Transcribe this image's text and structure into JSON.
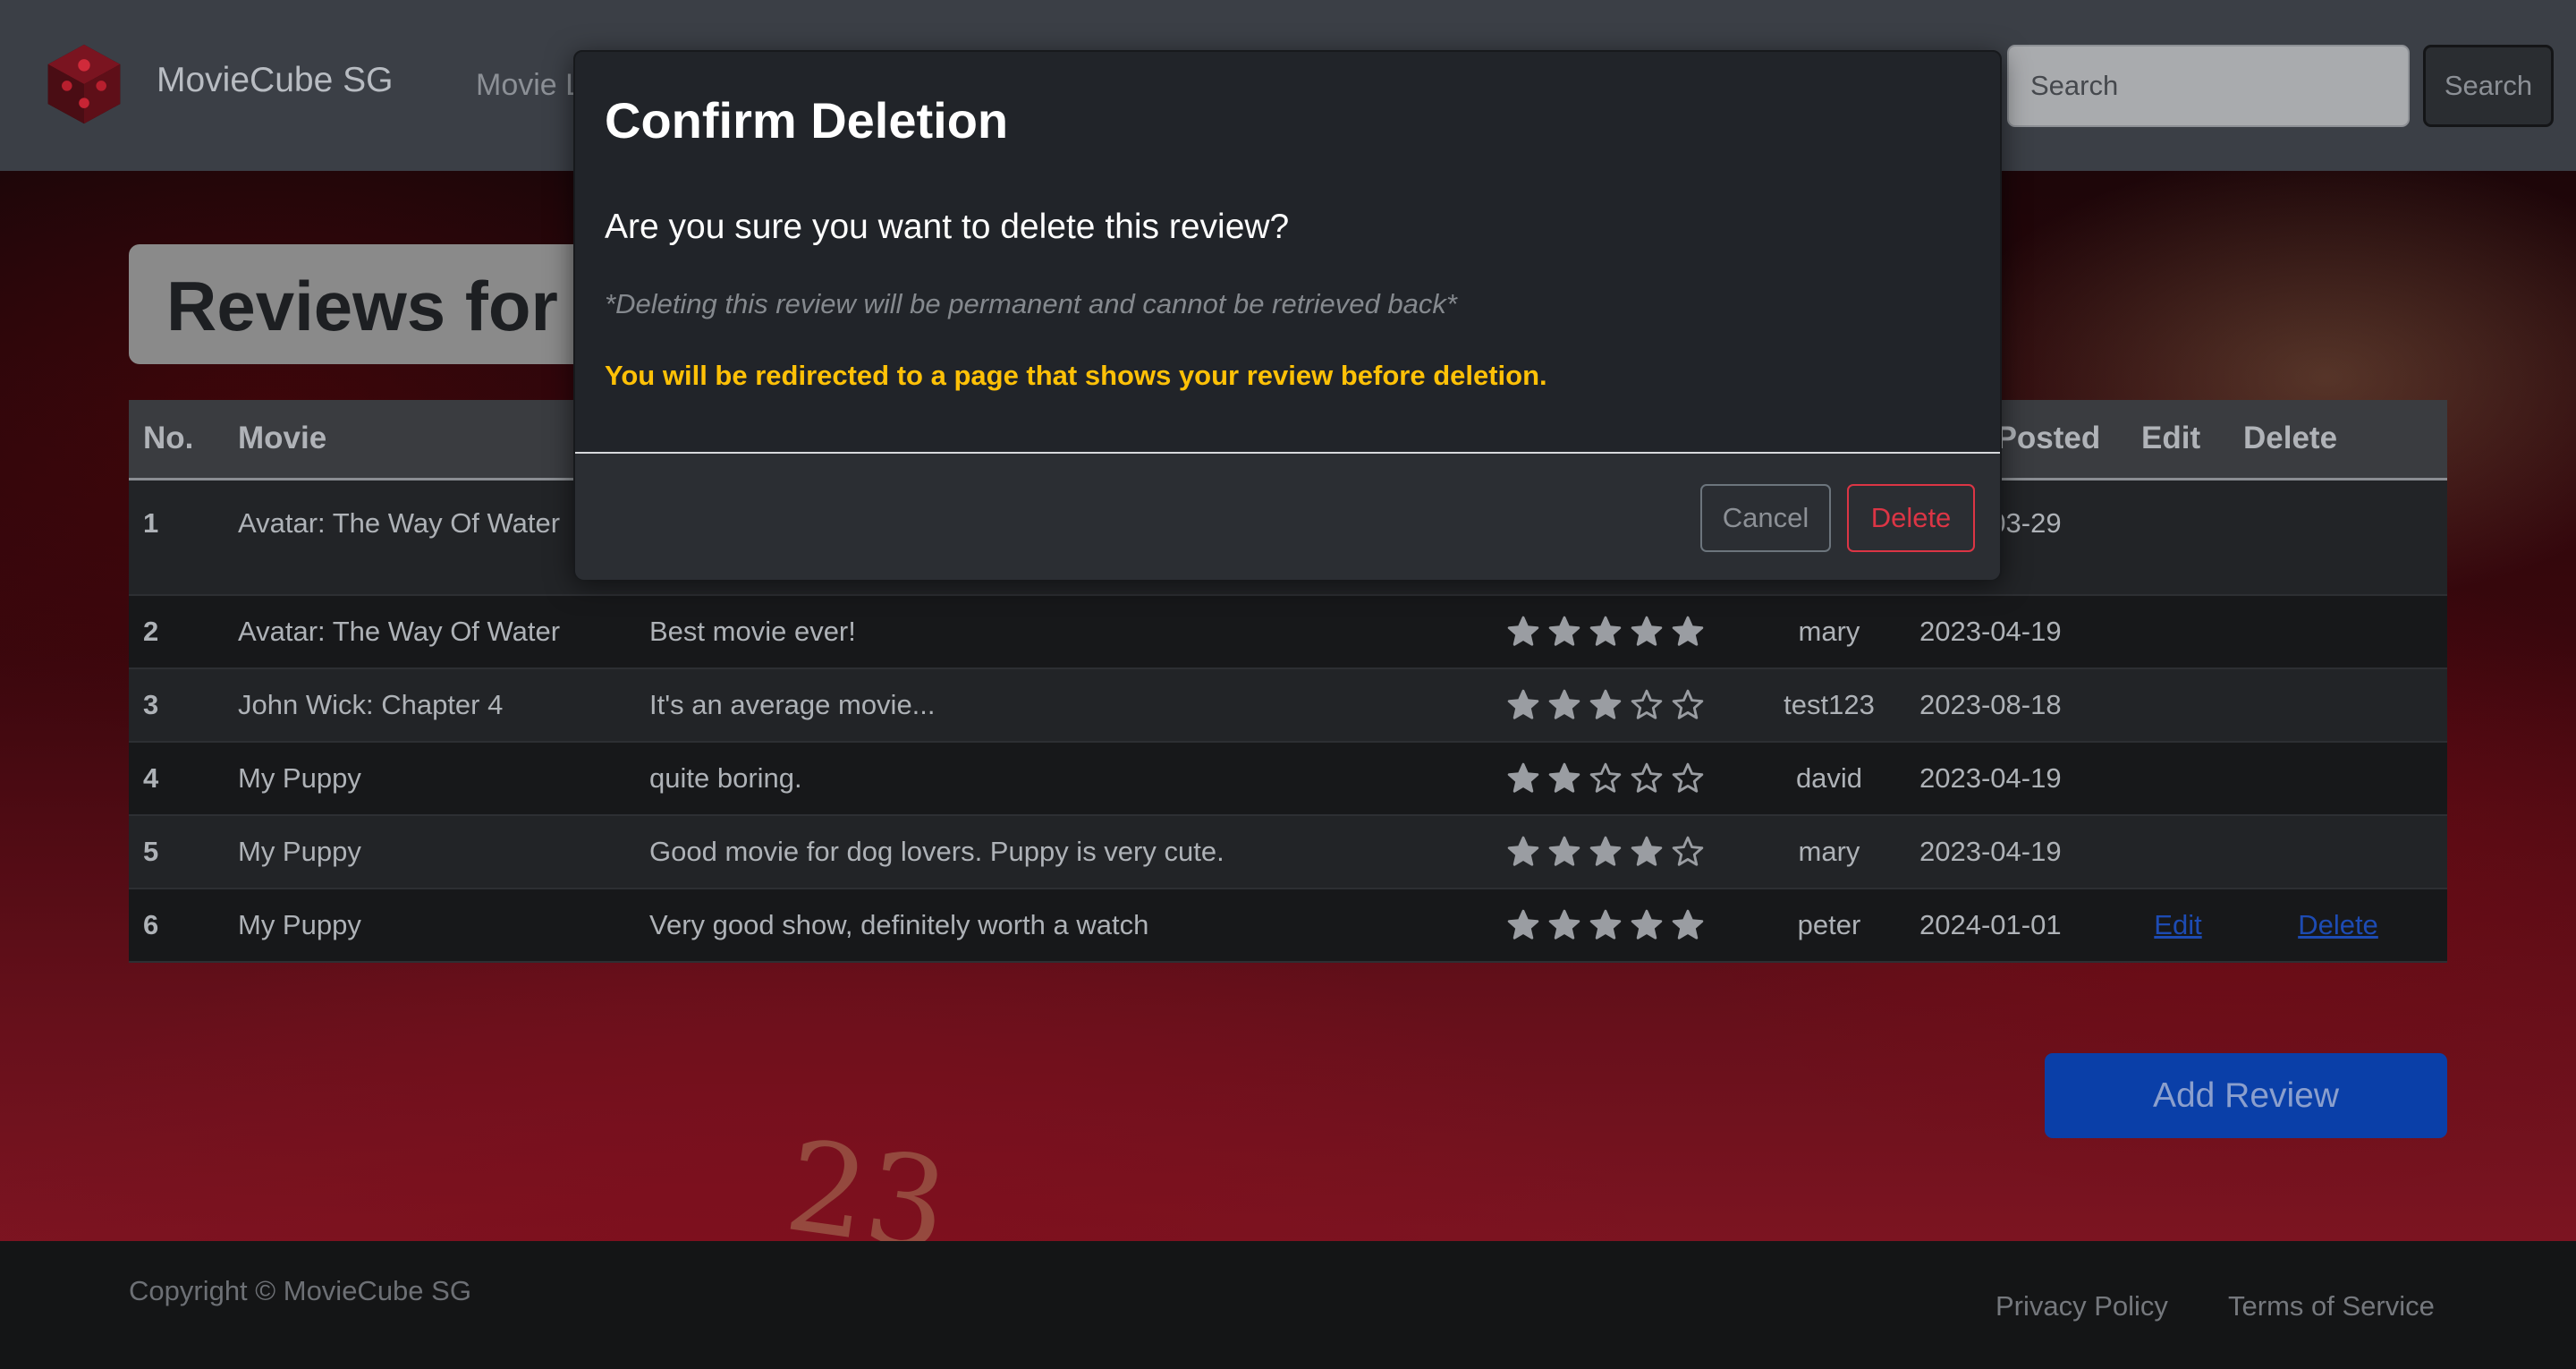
{
  "navbar": {
    "brand": "MovieCube SG",
    "nav_link": "Movie L",
    "search_placeholder": "Search",
    "search_button": "Search"
  },
  "page": {
    "heading": "Reviews for A"
  },
  "table": {
    "headers": {
      "no": "No.",
      "movie": "Movie",
      "date": "Date Posted",
      "edit": "Edit",
      "delete": "Delete"
    },
    "rows": [
      {
        "no": "1",
        "movie": "Avatar: The Way Of Water",
        "review": "",
        "rating": null,
        "user": "",
        "date": "2023-03-29"
      },
      {
        "no": "2",
        "movie": "Avatar: The Way Of Water",
        "review": "Best movie ever!",
        "rating": 5,
        "user": "mary",
        "date": "2023-04-19"
      },
      {
        "no": "3",
        "movie": "John Wick: Chapter 4",
        "review": "It's an average movie...",
        "rating": 3,
        "user": "test123",
        "date": "2023-08-18"
      },
      {
        "no": "4",
        "movie": "My Puppy",
        "review": "quite boring.",
        "rating": 2,
        "user": "david",
        "date": "2023-04-19"
      },
      {
        "no": "5",
        "movie": "My Puppy",
        "review": "Good movie for dog lovers. Puppy is very cute.",
        "rating": 4,
        "user": "mary",
        "date": "2023-04-19"
      },
      {
        "no": "6",
        "movie": "My Puppy",
        "review": "Very good show, definitely worth a watch",
        "rating": 5,
        "user": "peter",
        "date": "2024-01-01",
        "edit": "Edit",
        "delete": "Delete"
      }
    ]
  },
  "add_review_button": "Add Review",
  "footer": {
    "copyright": "Copyright © MovieCube SG",
    "privacy": "Privacy Policy",
    "terms": "Terms of Service"
  },
  "modal": {
    "title": "Confirm Deletion",
    "question": "Are you sure you want to delete this review?",
    "note": "*Deleting this review will be permanent and cannot be retrieved back*",
    "warning": "You will be redirected to a page that shows your review before deletion.",
    "cancel_label": "Cancel",
    "delete_label": "Delete"
  },
  "colors": {
    "navbar": "#3b3f46",
    "accent_blue": "#0a3fa8",
    "warning": "#ffc107",
    "danger": "#dc3545",
    "star": "#9a9da2"
  },
  "icons": {
    "logo": "red-cube-logo-icon",
    "star_filled": "star-filled-icon",
    "star_empty": "star-outline-icon"
  }
}
